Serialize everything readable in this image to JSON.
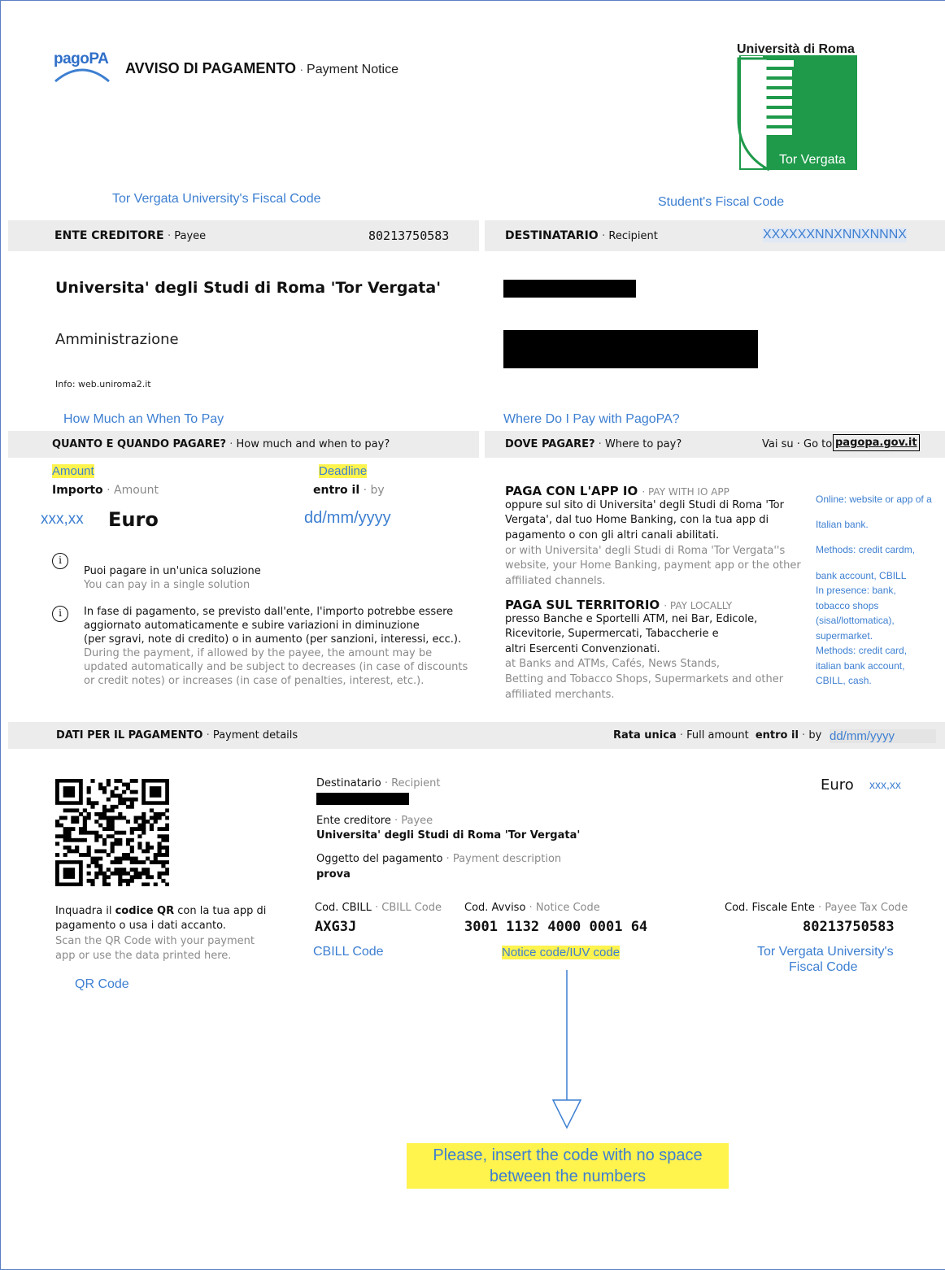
{
  "header": {
    "logo_text": "pagoPA",
    "title": "AVVISO DI PAGAMENTO",
    "title_en": "Payment Notice",
    "uni_logo_top": "Università di Roma",
    "uni_logo_bottom": "Tor Vergata"
  },
  "annotations": {
    "fiscal_code_label": "Tor Vergata University's Fiscal Code",
    "student_fiscal_code": "Student's Fiscal Code",
    "how_much": "How Much an When To Pay",
    "where_pay": "Where Do I Pay with PagoPA?",
    "amount": "Amount",
    "deadline": "Deadline",
    "amount_value": "xxx,xx",
    "deadline_value": "dd/mm/yyyy",
    "online_lines": [
      "Online: website or app of a",
      "Italian bank.",
      "Methods: credit cardm,",
      "bank account, CBILL",
      "In presence: bank,",
      "tobacco shops",
      "(sisal/lottomatica),",
      "supermarket.",
      "Methods: credit card,",
      "italian bank account,",
      "CBILL, cash."
    ],
    "full_date": "dd/mm/yyyy",
    "euro_value": "xxx,xx",
    "cbill_code": "CBILL Code",
    "notice_code": "Notice code/IUV code",
    "tax_code_1": "Tor Vergata University's",
    "tax_code_2": "Fiscal Code",
    "qr_code": "QR Code",
    "instruction_1": "Please, insert the code with no space",
    "instruction_2": "between the numbers"
  },
  "payee": {
    "label": "ENTE CREDITORE",
    "label_en": "Payee",
    "code": "80213750583",
    "name": "Universita' degli Studi di Roma 'Tor Vergata'",
    "dept": "Amministrazione",
    "info": "Info: web.uniroma2.it"
  },
  "recipient": {
    "label": "DESTINATARIO",
    "label_en": "Recipient",
    "code": "XXXXXXNNXNNXNNNX"
  },
  "when": {
    "label": "QUANTO E QUANDO PAGARE?",
    "label_en": "How much and when to pay?",
    "importo": "Importo",
    "importo_en": "Amount",
    "entro": "entro il",
    "entro_en": "by",
    "euro": "Euro",
    "note1_it": "Puoi pagare in un'unica soluzione",
    "note1_en": "You can pay in a single solution",
    "note2_it": [
      "In fase di pagamento, se previsto dall'ente, l'importo potrebbe essere",
      "aggiornato automaticamente e subire variazioni in diminuzione",
      "(per sgravi, note di credito) o in aumento (per sanzioni, interessi, ecc.)."
    ],
    "note2_en": [
      "During the payment, if allowed by the payee, the amount may be",
      "updated automatically and be subject to decreases (in case of discounts",
      "or credit notes) or increases (in case of penalties, interest, etc.)."
    ]
  },
  "where": {
    "label": "DOVE PAGARE?",
    "label_en": "Where to pay?",
    "goto": "Vai su · Go to",
    "site": "pagopa.gov.it",
    "app_title": "PAGA CON L'APP IO",
    "app_title_en": "PAY WITH IO APP",
    "app_it": [
      "oppure sul sito di Universita' degli Studi di Roma 'Tor",
      "Vergata', dal tuo Home Banking, con la tua app di",
      "pagamento o con gli altri canali abilitati."
    ],
    "app_en": [
      "or with Universita' degli Studi di Roma 'Tor Vergata''s",
      "website, your Home Banking, payment app or the other",
      "affiliated channels."
    ],
    "local_title": "PAGA SUL TERRITORIO",
    "local_title_en": "PAY LOCALLY",
    "local_it": [
      "presso Banche e Sportelli ATM, nei Bar, Edicole,",
      "Ricevitorie, Supermercati, Tabaccherie e",
      "altri Esercenti Convenzionati."
    ],
    "local_en": [
      "at Banks and ATMs, Cafés, News Stands,",
      "Betting and Tobacco Shops, Supermarkets and other",
      "affiliated merchants."
    ]
  },
  "details": {
    "label": "DATI PER IL PAGAMENTO",
    "label_en": "Payment details",
    "rata": "Rata unica",
    "rata_en": "Full amount",
    "entro": "entro il",
    "by": "by",
    "euro": "Euro",
    "dest_label": "Destinatario",
    "dest_en": "Recipient",
    "ente_label": "Ente creditore",
    "ente_en": "Payee",
    "ente_name": "Universita' degli Studi di Roma 'Tor Vergata'",
    "oggetto_label": "Oggetto del pagamento",
    "oggetto_en": "Payment description",
    "oggetto_value": "prova",
    "qr_it_pre": "Inquadra il ",
    "qr_it_bold": "codice QR",
    "qr_it_post": " con la tua app di",
    "qr_it_2": "pagamento o usa i dati accanto.",
    "qr_en_1": "Scan the QR Code with your payment",
    "qr_en_2": "app or use the data printed here.",
    "cbill_label": "Cod. CBILL",
    "cbill_en": "CBILL Code",
    "cbill_value": "AXG3J",
    "avviso_label": "Cod. Avviso",
    "avviso_en": "Notice Code",
    "avviso_value": "3001 1132 4000 0001 64",
    "cf_label": "Cod. Fiscale Ente",
    "cf_en": "Payee Tax Code",
    "cf_value": "80213750583"
  }
}
